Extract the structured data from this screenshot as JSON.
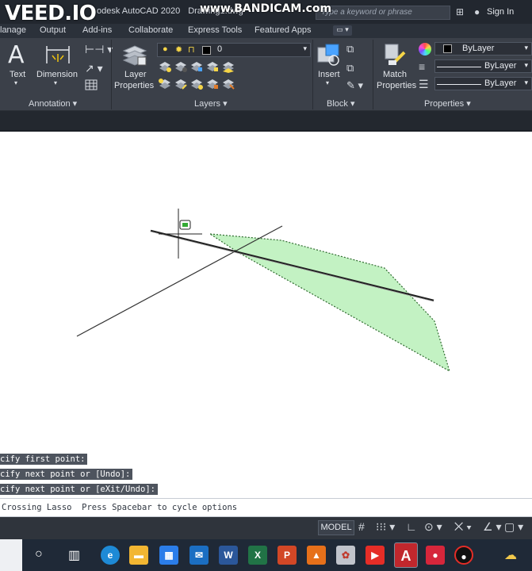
{
  "watermarks": {
    "veed": "VEED.IO",
    "bandicam": "www.BANDICAM.com"
  },
  "titlebar": {
    "app_title": "Autodesk AutoCAD 2020",
    "app_title_visible": "odesk AutoCAD 2020",
    "document": "Drawing1.dwg",
    "search_placeholder": "Type a keyword or phrase",
    "signin_label": "Sign In"
  },
  "menu_tabs": [
    {
      "label": "lanage"
    },
    {
      "label": "Output"
    },
    {
      "label": "Add-ins"
    },
    {
      "label": "Collaborate"
    },
    {
      "label": "Express Tools"
    },
    {
      "label": "Featured Apps"
    }
  ],
  "ribbon": {
    "annotation": {
      "text_label": "Text",
      "dimension_label": "Dimension",
      "panel_title": "Annotation ▾"
    },
    "layers": {
      "layer_properties_label_1": "Layer",
      "layer_properties_label_2": "Properties",
      "current_layer": "0",
      "panel_title": "Layers ▾"
    },
    "block": {
      "insert_label": "Insert",
      "panel_title": "Block ▾"
    },
    "properties": {
      "match_label_1": "Match",
      "match_label_2": "Properties",
      "color_value": "ByLayer",
      "linetype_value": "ByLayer",
      "lineweight_value": "ByLayer",
      "panel_title": "Properties ▾"
    }
  },
  "command_history": [
    "cify first point:",
    "cify next point or [Undo]:",
    "cify next point or [eXit/Undo]:"
  ],
  "command_line": {
    "prompt": "Crossing Lasso  Press Spacebar to cycle options"
  },
  "statusbar": {
    "model_label": "MODEL"
  },
  "colors": {
    "lasso_fill": "#b8f0b8",
    "lasso_stroke": "#2f6b2f",
    "ribbon_bg": "#3b4049",
    "title_bg": "#22272f",
    "taskbar_bg": "#1f2937"
  }
}
